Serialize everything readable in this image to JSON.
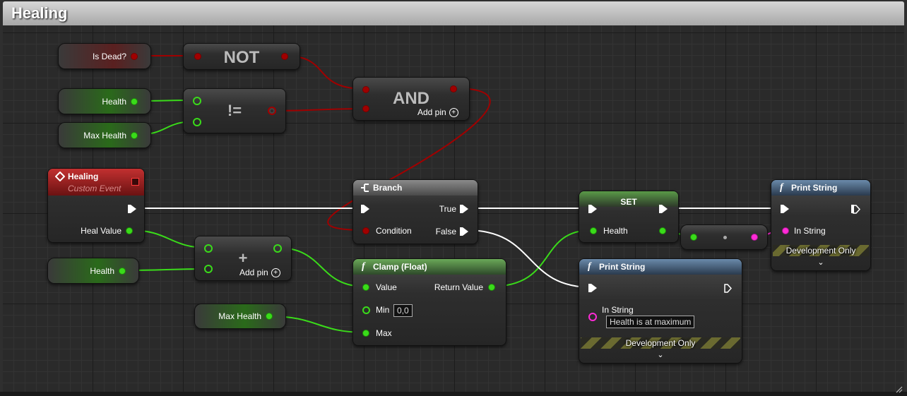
{
  "window": {
    "title": "Healing"
  },
  "nodes": {
    "is_dead": {
      "label": "Is Dead?"
    },
    "not": {
      "label": "NOT"
    },
    "health_var_1": {
      "label": "Health"
    },
    "max_health_var_1": {
      "label": "Max Health"
    },
    "not_equal": {
      "label": "!="
    },
    "and": {
      "label": "AND",
      "add_pin": "Add pin"
    },
    "event": {
      "title": "Healing",
      "subtitle": "Custom Event",
      "pin_heal_value": "Heal Value"
    },
    "branch": {
      "title": "Branch",
      "pin_condition": "Condition",
      "pin_true": "True",
      "pin_false": "False"
    },
    "set": {
      "title": "SET",
      "pin_health": "Health"
    },
    "print_top": {
      "title": "Print String",
      "pin_in_string": "In String",
      "dev_only": "Development Only"
    },
    "health_var_2": {
      "label": "Health"
    },
    "add": {
      "label": "+",
      "add_pin": "Add pin"
    },
    "clamp": {
      "title": "Clamp (Float)",
      "pin_value": "Value",
      "pin_min": "Min",
      "min_value": "0,0",
      "pin_max": "Max",
      "pin_return": "Return Value"
    },
    "max_health_var_2": {
      "label": "Max Health"
    },
    "print_bottom": {
      "title": "Print String",
      "pin_in_string": "In String",
      "in_string_value": "Health is at maximum",
      "dev_only": "Development Only"
    }
  },
  "colors": {
    "bool_wire": "#a00000",
    "float_wire": "#3adb1a",
    "exec_wire": "#ffffff",
    "string_pin": "#ff2bd6"
  },
  "icons": [
    "event-diamond-icon",
    "branch-icon",
    "function-icon",
    "add-pin-icon",
    "chevron-down-icon"
  ]
}
